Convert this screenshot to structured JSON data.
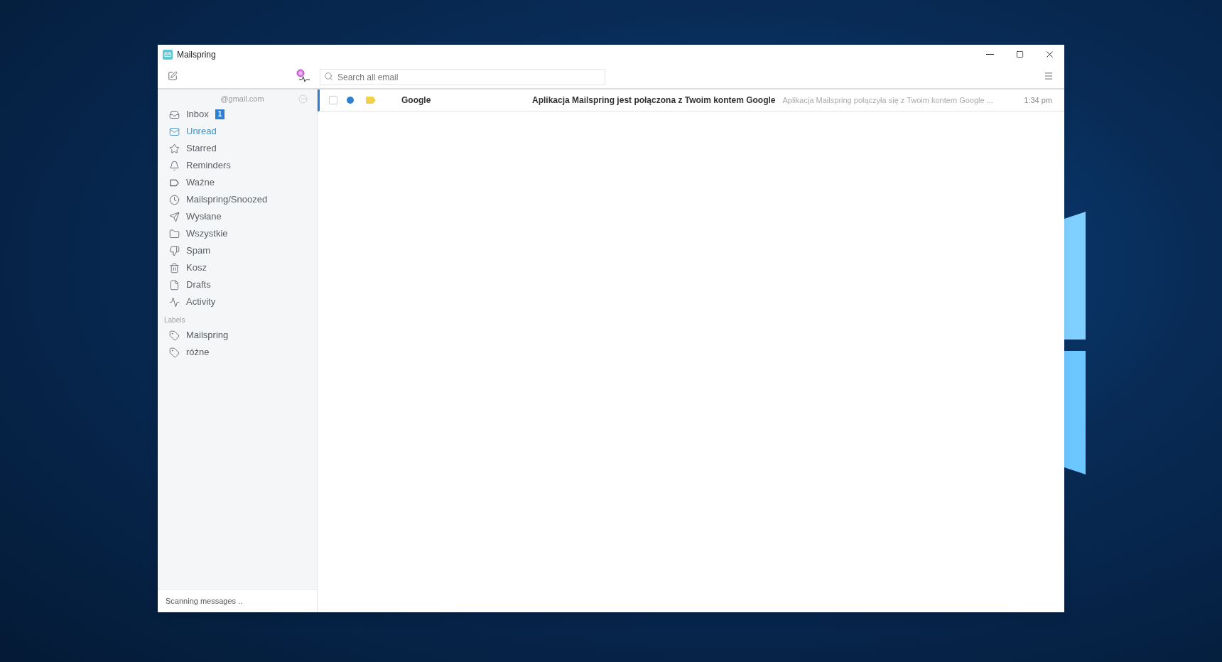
{
  "window": {
    "title": "Mailspring"
  },
  "search": {
    "placeholder": "Search all email"
  },
  "sidebar": {
    "account": "@gmail.com",
    "items": [
      {
        "kind": "inbox",
        "label": "Inbox",
        "count": "1",
        "selected": false
      },
      {
        "kind": "unread",
        "label": "Unread",
        "selected": true
      },
      {
        "kind": "starred",
        "label": "Starred",
        "selected": false
      },
      {
        "kind": "reminders",
        "label": "Reminders",
        "selected": false
      },
      {
        "kind": "important",
        "label": "Ważne",
        "selected": false
      },
      {
        "kind": "snoozed",
        "label": "Mailspring/Snoozed",
        "selected": false
      },
      {
        "kind": "sent",
        "label": "Wysłane",
        "selected": false
      },
      {
        "kind": "all",
        "label": "Wszystkie",
        "selected": false
      },
      {
        "kind": "spam",
        "label": "Spam",
        "selected": false
      },
      {
        "kind": "trash",
        "label": "Kosz",
        "selected": false
      },
      {
        "kind": "drafts",
        "label": "Drafts",
        "selected": false
      },
      {
        "kind": "activity",
        "label": "Activity",
        "selected": false
      }
    ],
    "labels_heading": "Labels",
    "labels": [
      {
        "label": "Mailspring",
        "selected": false
      },
      {
        "label": "różne",
        "selected": false
      }
    ]
  },
  "messages": [
    {
      "from": "Google",
      "subject": "Aplikacja Mailspring jest połączona z Twoim kontem Google",
      "snippet": "Aplikacja Mailspring połączyła się z Twoim kontem Google ...",
      "time": "1:34 pm",
      "checked": false,
      "unread": true,
      "important": true,
      "focused": true
    }
  ],
  "status_bar": "Scanning messages .."
}
